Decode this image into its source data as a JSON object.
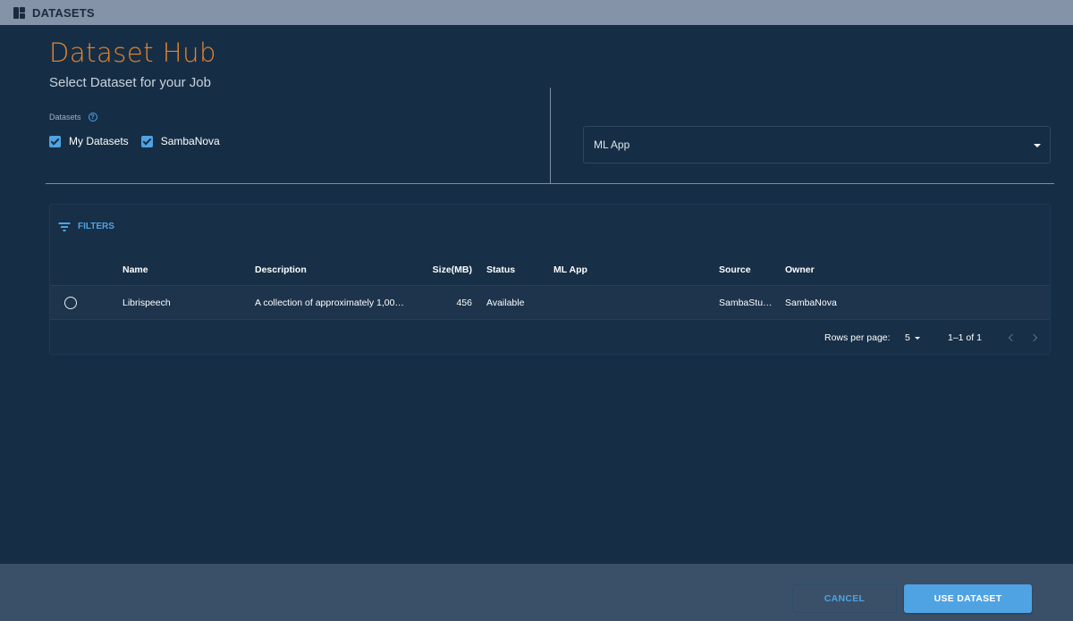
{
  "topbar": {
    "title": "DATASETS",
    "icon": "dashboard-icon"
  },
  "header": {
    "title": "Dataset Hub",
    "subtitle": "Select Dataset for your Job"
  },
  "datasets_filter": {
    "label": "Datasets",
    "help_icon": "help-circle-icon",
    "options": [
      {
        "label": "My Datasets",
        "checked": true
      },
      {
        "label": "SambaNova",
        "checked": true
      }
    ]
  },
  "ml_app_select": {
    "value": "ML App"
  },
  "table": {
    "filters_label": "FILTERS",
    "columns": [
      "Name",
      "Description",
      "Size(MB)",
      "Status",
      "ML App",
      "Source",
      "Owner"
    ],
    "rows": [
      {
        "selected": false,
        "name": "Librispeech",
        "description": "A collection of approximately 1,00…",
        "size": "456",
        "status": "Available",
        "ml_app": "",
        "source": "SambaStu…",
        "owner": "SambaNova"
      }
    ],
    "pagination": {
      "rows_per_page_label": "Rows per page:",
      "rows_per_page": "5",
      "range": "1–1 of 1"
    }
  },
  "actions": {
    "cancel": "CANCEL",
    "use": "USE DATASET"
  },
  "colors": {
    "accent": "#4fa3e3",
    "title": "#e8842a",
    "background": "#162e45"
  }
}
